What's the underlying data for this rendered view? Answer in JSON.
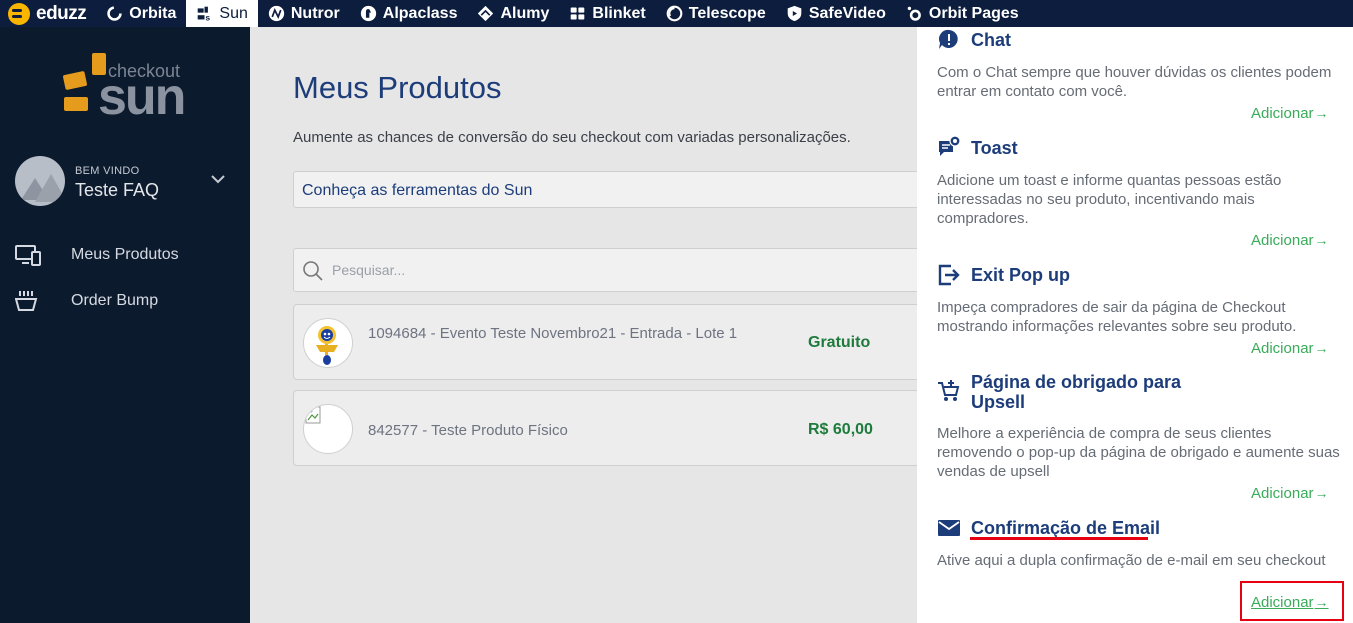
{
  "topbar": {
    "brand": "eduzz",
    "tabs": [
      {
        "label": "Orbita",
        "icon": "orbita-icon"
      },
      {
        "label": "Sun",
        "icon": "sun-icon"
      },
      {
        "label": "Nutror",
        "icon": "nutror-icon"
      },
      {
        "label": "Alpaclass",
        "icon": "alpaclass-icon"
      },
      {
        "label": "Alumy",
        "icon": "alumy-icon"
      },
      {
        "label": "Blinket",
        "icon": "blinket-icon"
      },
      {
        "label": "Telescope",
        "icon": "telescope-icon"
      },
      {
        "label": "SafeVideo",
        "icon": "safevideo-icon"
      },
      {
        "label": "Orbit Pages",
        "icon": "orbit-pages-icon"
      }
    ],
    "active_tab": "Sun"
  },
  "sidebar": {
    "logo_top": "checkout",
    "logo_main": "sun",
    "welcome": "BEM VINDO",
    "user_name": "Teste FAQ",
    "items": [
      {
        "label": "Meus Produtos",
        "icon": "monitor-icon"
      },
      {
        "label": "Order Bump",
        "icon": "basket-icon"
      }
    ]
  },
  "main": {
    "title": "Meus Produtos",
    "subtitle": "Aumente as chances de conversão do seu checkout com variadas personalizações.",
    "tools_label": "Conheça as ferramentas do Sun",
    "search_placeholder": "Pesquisar...",
    "products": [
      {
        "name": "1094684 - Evento Teste Novembro21 - Entrada - Lote 1",
        "price": "Gratuito"
      },
      {
        "name": "842577 - Teste Produto Físico",
        "price": "R$ 60,00"
      }
    ]
  },
  "panel": {
    "add_label": "Adicionar",
    "items": [
      {
        "title": "Chat",
        "icon": "chat-icon",
        "desc": "Com o Chat sempre que houver dúvidas os clientes podem entrar em contato com você."
      },
      {
        "title": "Toast",
        "icon": "toast-icon",
        "desc": "Adicione um toast e informe quantas pessoas estão interessadas no seu produto, incentivando mais compradores."
      },
      {
        "title": "Exit Pop up",
        "icon": "exit-icon",
        "desc": "Impeça compradores de sair da página de Checkout mostrando informações relevantes sobre seu produto."
      },
      {
        "title": "Página de obrigado para Upsell",
        "icon": "cart-icon",
        "desc": "Melhore a experiência de compra de seus clientes removendo o pop-up da página de obrigado e aumente suas vendas de upsell"
      },
      {
        "title": "Confirmação de Email",
        "icon": "email-icon",
        "desc": "Ative aqui a dupla confirmação de e-mail em seu checkout"
      }
    ]
  },
  "colors": {
    "topbar": "#0c1d3d",
    "sidebar": "#0c1a2d",
    "accent_blue": "#1d3d7a",
    "add_green": "#3aab5a",
    "price_green": "#1e7b3c",
    "highlight_red": "#e60012"
  }
}
